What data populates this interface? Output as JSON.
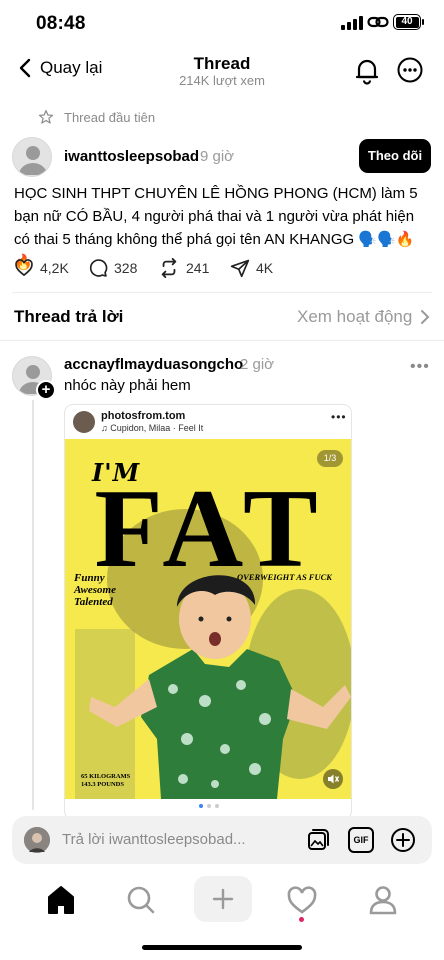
{
  "status_bar": {
    "time": "08:48",
    "battery": "40"
  },
  "header": {
    "back_label": "Quay lại",
    "title": "Thread",
    "subtitle": "214K lượt xem"
  },
  "post": {
    "first_thread_label": "Thread đầu tiên",
    "username": "iwanttosleepsobad",
    "time_ago": "9 giờ",
    "follow_label": "Theo dõi",
    "text": "HỌC SINH THPT CHUYÊN LÊ HỒNG PHONG (HCM) làm 5 bạn nữ CÓ BẦU, 4 người phá thai và 1 người vừa phát hiện có thai 5 tháng không thể phá gọi tên AN KHANGG 🗣️🗣️🔥🔥",
    "likes": "4,2K",
    "comments": "328",
    "reposts": "241",
    "shares": "4K"
  },
  "replies_section": {
    "title": "Thread trả lời",
    "activity_label": "Xem hoạt động"
  },
  "reply": {
    "username": "accnayflmayduasongcho",
    "time_ago": "2 giờ",
    "text": "nhóc này phải hem",
    "card": {
      "username": "photosfrom.tom",
      "music": "Cupidon, Milaa · Feel It",
      "pager": "1/3",
      "poster_im": "I'M",
      "poster_fat": "FAT",
      "poster_funny": [
        "Funny",
        "Awesome",
        "Talented"
      ],
      "poster_overweight": "OVERWEIGHT AS FUCK",
      "poster_kilos": [
        "65 KILOGRAMS",
        "143.3 POUNDS"
      ],
      "carousel_count": 3,
      "carousel_active": 0
    }
  },
  "reply_bar": {
    "placeholder": "Trả lời iwanttosleepsobad...",
    "gif_label": "GIF"
  },
  "colors": {
    "accent": "#000000",
    "poster_bg": "#f6e94d",
    "notification_dot": "#e0245e",
    "shirt": "#2e7d3a"
  }
}
